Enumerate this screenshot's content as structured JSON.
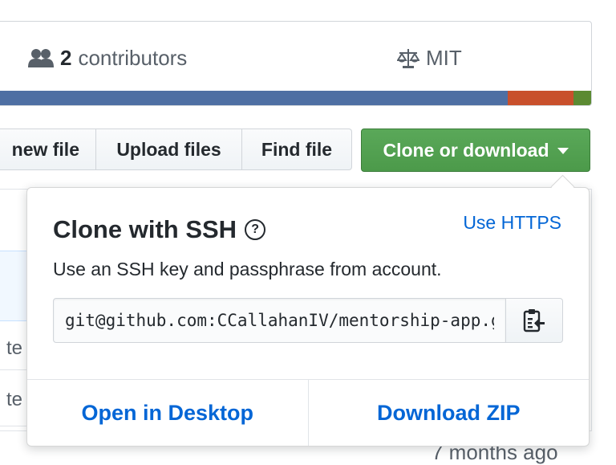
{
  "summary": {
    "contributors_count": "2",
    "contributors_label": "contributors",
    "license": "MIT",
    "languages": [
      {
        "color": "#4e6fa3",
        "share": 0.86
      },
      {
        "color": "#c8502c",
        "share": 0.11
      },
      {
        "color": "#5b8a32",
        "share": 0.03
      }
    ]
  },
  "toolbar": {
    "create_new_file": "new file",
    "upload_files": "Upload files",
    "find_file": "Find file",
    "clone_download": "Clone or download"
  },
  "background": {
    "row_fragment_1": "l te",
    "row_fragment_2": "l te",
    "time_ago": "7 months ago"
  },
  "clone": {
    "title": "Clone with SSH",
    "switch_link": "Use HTTPS",
    "description": "Use an SSH key and passphrase from account.",
    "url": "git@github.com:CCallahanIV/mentorship-app.git",
    "open_desktop": "Open in Desktop",
    "download_zip": "Download ZIP"
  },
  "colors": {
    "accent_green": "#4c9a4a",
    "link_blue": "#0366d6"
  }
}
